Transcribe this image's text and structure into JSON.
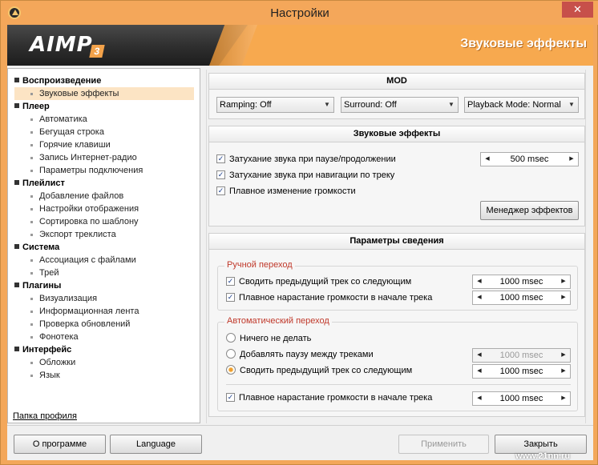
{
  "window": {
    "title": "Настройки",
    "close": "✕"
  },
  "banner": {
    "logo": "AIMP",
    "logo_version": "3",
    "section_title": "Звуковые эффекты"
  },
  "nav": {
    "groups": [
      {
        "label": "Воспроизведение",
        "items": [
          "Звуковые эффекты"
        ]
      },
      {
        "label": "Плеер",
        "items": [
          "Автоматика",
          "Бегущая строка",
          "Горячие клавиши",
          "Запись Интернет-радио",
          "Параметры подключения"
        ]
      },
      {
        "label": "Плейлист",
        "items": [
          "Добавление файлов",
          "Настройки отображения",
          "Сортировка по шаблону",
          "Экспорт треклиста"
        ]
      },
      {
        "label": "Система",
        "items": [
          "Ассоциация с файлами",
          "Трей"
        ]
      },
      {
        "label": "Плагины",
        "items": [
          "Визуализация",
          "Информационная лента",
          "Проверка обновлений",
          "Фонотека"
        ]
      },
      {
        "label": "Интерфейс",
        "items": [
          "Обложки",
          "Язык"
        ]
      }
    ],
    "selected": "Звуковые эффекты",
    "profile_link": "Папка профиля"
  },
  "mod": {
    "title": "MOD",
    "ramping": "Ramping: Off",
    "surround": "Surround: Off",
    "playback": "Playback Mode: Normal"
  },
  "effects": {
    "title": "Звуковые эффекты",
    "fade_pause": {
      "label": "Затухание звука при паузе/продолжении",
      "checked": true
    },
    "fade_seek": {
      "label": "Затухание звука при навигации по треку",
      "checked": true
    },
    "smooth_volume": {
      "label": "Плавное изменение громкости",
      "checked": true
    },
    "fade_value": "500 msec",
    "manager_button": "Менеджер эффектов"
  },
  "mixing": {
    "title": "Параметры сведения",
    "manual": {
      "title": "Ручной переход",
      "crossfade": {
        "label": "Сводить предыдущий трек со следующим",
        "checked": true,
        "value": "1000 msec"
      },
      "fadein": {
        "label": "Плавное нарастание громкости в начале трека",
        "checked": true,
        "value": "1000 msec"
      }
    },
    "auto": {
      "title": "Автоматический переход",
      "nothing": {
        "label": "Ничего не делать",
        "selected": false
      },
      "pause": {
        "label": "Добавлять паузу между треками",
        "selected": false,
        "value": "1000 msec"
      },
      "crossfade": {
        "label": "Сводить предыдущий трек со следующим",
        "selected": true,
        "value": "1000 msec"
      },
      "fadein": {
        "label": "Плавное нарастание громкости в начале трека",
        "checked": true,
        "value": "1000 msec"
      }
    }
  },
  "buttons": {
    "about": "О программе",
    "language": "Language",
    "apply": "Применить",
    "close": "Закрыть"
  },
  "watermark": "www.21nn.ru",
  "colors": {
    "accent": "#f3a75a",
    "group_title": "#c0392b",
    "selection": "#fce4c4"
  }
}
